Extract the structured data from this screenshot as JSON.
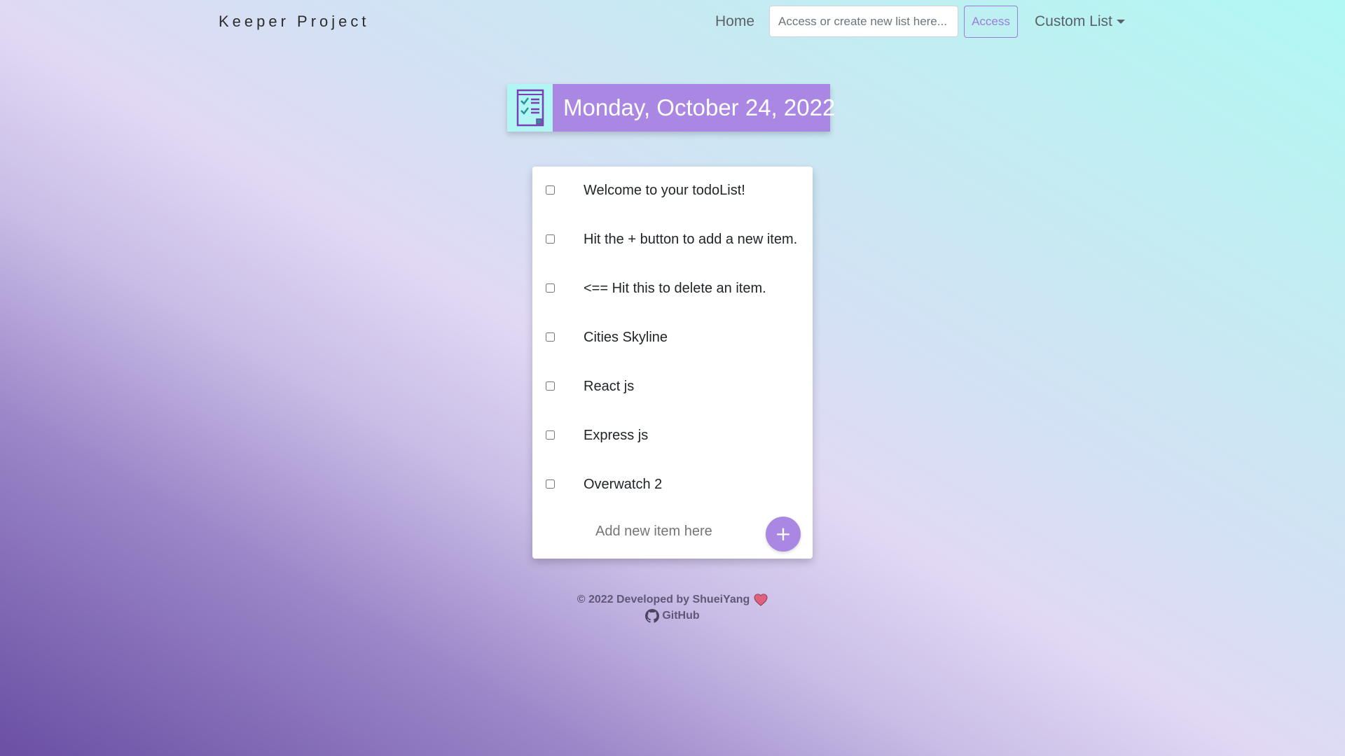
{
  "navbar": {
    "brand": "Keeper Project",
    "home_label": "Home",
    "search_placeholder": "Access or create new list here...",
    "access_label": "Access",
    "dropdown_label": "Custom List"
  },
  "header": {
    "icon": "checklist-icon",
    "date": "Monday, October 24, 2022"
  },
  "todo": {
    "items": [
      {
        "text": "Welcome to your todoList!",
        "checked": false
      },
      {
        "text": "Hit the + button to add a new item.",
        "checked": false
      },
      {
        "text": "<== Hit this to delete an item.",
        "checked": false
      },
      {
        "text": "Cities Skyline",
        "checked": false
      },
      {
        "text": "React js",
        "checked": false
      },
      {
        "text": "Express js",
        "checked": false
      },
      {
        "text": "Overwatch 2",
        "checked": false
      }
    ],
    "add_placeholder": "Add new item here",
    "add_button_label": "+"
  },
  "footer": {
    "copyright": "© 2022 Developed by ShueiYang",
    "heart_icon": "heart-icon",
    "github_icon": "github-icon",
    "github_label": "GitHub"
  },
  "colors": {
    "accent": "#a987e3",
    "icon_bg": "#b1f6f4",
    "access_border": "#9b7ddb"
  }
}
